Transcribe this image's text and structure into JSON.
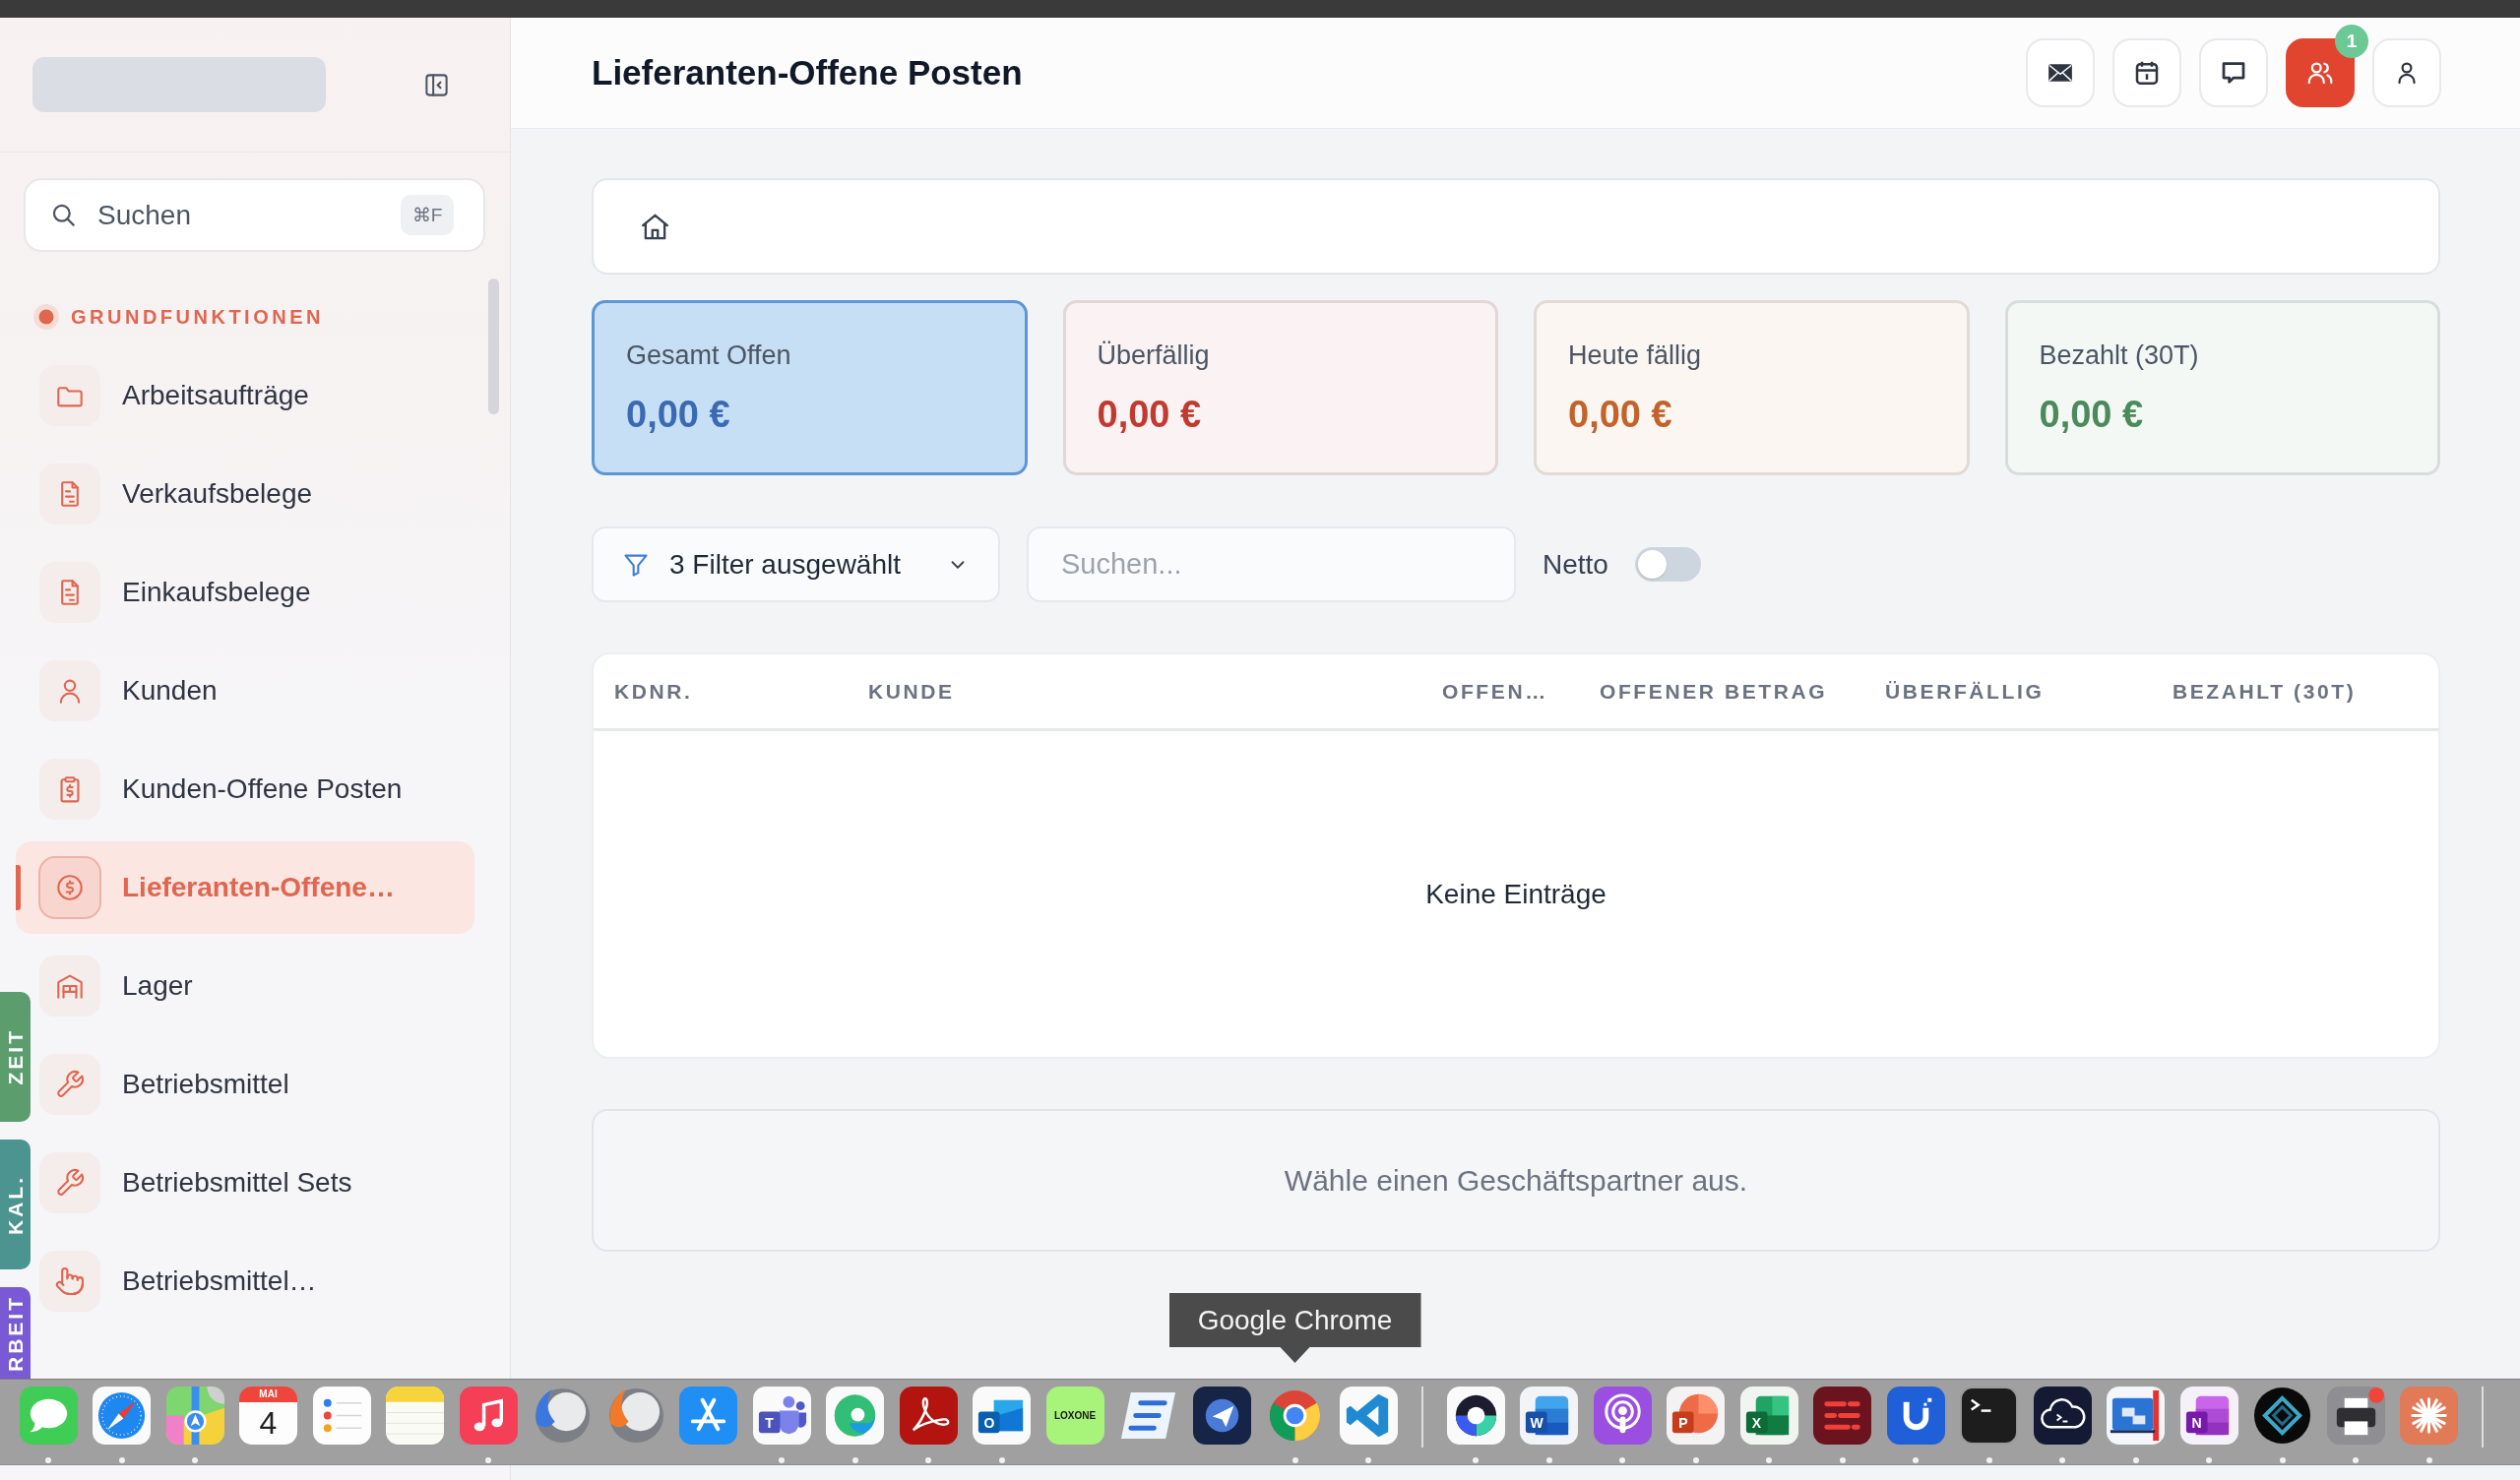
{
  "window": {
    "title": "Lieferanten-Offene Posten"
  },
  "sidebar": {
    "search": {
      "placeholder": "Suchen",
      "shortcut": "⌘F"
    },
    "section": "GRUNDFUNKTIONEN",
    "items": [
      {
        "label": "Arbeitsaufträge",
        "kind": "folder",
        "selected": false
      },
      {
        "label": "Verkaufsbelege",
        "kind": "document",
        "selected": false
      },
      {
        "label": "Einkaufsbelege",
        "kind": "document",
        "selected": false
      },
      {
        "label": "Kunden",
        "kind": "person",
        "selected": false
      },
      {
        "label": "Kunden-Offene Posten",
        "kind": "receipt",
        "selected": false
      },
      {
        "label": "Lieferanten-Offene…",
        "kind": "payment",
        "selected": true
      },
      {
        "label": "Lager",
        "kind": "warehouse",
        "selected": false
      },
      {
        "label": "Betriebsmittel",
        "kind": "tool",
        "selected": false
      },
      {
        "label": "Betriebsmittel Sets",
        "kind": "tool",
        "selected": false
      },
      {
        "label": "Betriebsmittel…",
        "kind": "hand",
        "selected": false
      }
    ]
  },
  "side_tabs": [
    {
      "label": "ZEIT",
      "color": "#5b9d6d"
    },
    {
      "label": "KAL.",
      "color": "#4b9490"
    },
    {
      "label": "RBEIT",
      "color": "#7a5ad4"
    }
  ],
  "header_buttons": [
    {
      "kind": "mail",
      "active": false
    },
    {
      "kind": "calendar",
      "active": false
    },
    {
      "kind": "chat",
      "active": false
    },
    {
      "kind": "team",
      "active": true,
      "badge": "1"
    },
    {
      "kind": "profile",
      "active": false
    }
  ],
  "cards": [
    {
      "label": "Gesamt Offen",
      "value": "0,00 €",
      "color": "#3a6bb2",
      "selected": true
    },
    {
      "label": "Überfällig",
      "value": "0,00 €",
      "color": "#c13a2f",
      "selected": false
    },
    {
      "label": "Heute fällig",
      "value": "0,00 €",
      "color": "#c2632c",
      "selected": false
    },
    {
      "label": "Bezahlt (30T)",
      "value": "0,00 €",
      "color": "#4a8a5b",
      "selected": false
    }
  ],
  "toolbar": {
    "filter": "3 Filter ausgewählt",
    "search": {
      "placeholder": "Suchen..."
    },
    "netto": {
      "label": "Netto",
      "on": false
    }
  },
  "table": {
    "columns": [
      "KDNR.",
      "KUNDE",
      "OFFEN…",
      "OFFENER BETRAG",
      "ÜBERFÄLLIG",
      "BEZAHLT (30T)"
    ],
    "empty_text": "Keine Einträge"
  },
  "detail": {
    "message": "Wähle einen Geschäftspartner aus."
  },
  "dock": {
    "apps": [
      {
        "kind": "chat",
        "running": true
      },
      {
        "kind": "compass",
        "running": true
      },
      {
        "kind": "map",
        "running": true
      },
      {
        "kind": "calendar",
        "month": "MAI",
        "day": "4",
        "running": false
      },
      {
        "kind": "checklist",
        "running": false
      },
      {
        "kind": "notepad",
        "running": false
      },
      {
        "kind": "music",
        "running": true
      },
      {
        "kind": "sphere_cool",
        "running": false
      },
      {
        "kind": "sphere_warm",
        "running": false
      },
      {
        "kind": "app_store",
        "running": false
      },
      {
        "kind": "people_tile",
        "glyph": "T",
        "running": true
      },
      {
        "kind": "swirl",
        "running": true
      },
      {
        "kind": "pdf",
        "running": true
      },
      {
        "kind": "mail_tile",
        "glyph": "O",
        "running": true
      },
      {
        "kind": "wordmark",
        "label": "LOXONE",
        "running": false
      },
      {
        "kind": "stripes",
        "running": false
      },
      {
        "kind": "paper_plane",
        "running": false
      },
      {
        "kind": "browser",
        "tooltip": "Google Chrome",
        "running": true
      },
      {
        "kind": "code",
        "running": true
      }
    ],
    "recent_apps": [
      {
        "kind": "ring",
        "running": true
      },
      {
        "kind": "doc_tile",
        "glyph": "W",
        "running": true
      },
      {
        "kind": "podcast",
        "running": true
      },
      {
        "kind": "slides_tile",
        "glyph": "P",
        "running": true
      },
      {
        "kind": "sheet_tile",
        "glyph": "X",
        "running": true
      },
      {
        "kind": "dashes",
        "running": true
      },
      {
        "kind": "u_shape",
        "running": true
      },
      {
        "kind": "terminal",
        "running": true
      },
      {
        "kind": "cloud_terminal",
        "running": true
      },
      {
        "kind": "screens",
        "running": true
      },
      {
        "kind": "notes_tile",
        "glyph": "N",
        "running": true
      },
      {
        "kind": "diamond",
        "running": true
      },
      {
        "kind": "printer",
        "running": true
      },
      {
        "kind": "starburst",
        "running": true
      }
    ]
  }
}
